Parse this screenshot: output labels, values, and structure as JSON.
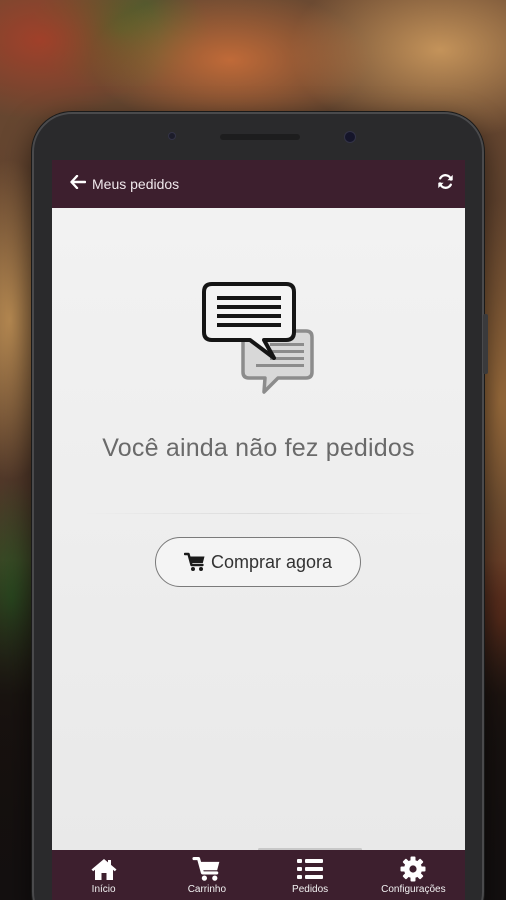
{
  "header": {
    "title": "Meus pedidos",
    "back_icon": "arrow-left-icon",
    "refresh_icon": "refresh-icon"
  },
  "empty_state": {
    "icon": "chat-bubbles-icon",
    "message": "Você ainda não fez pedidos",
    "button_icon": "shopping-cart-icon",
    "button_label": "Comprar agora"
  },
  "bottom_nav": {
    "items": [
      {
        "label": "Início",
        "icon": "home-icon"
      },
      {
        "label": "Carrinho",
        "icon": "cart-icon"
      },
      {
        "label": "Pedidos",
        "icon": "list-icon"
      },
      {
        "label": "Configurações",
        "icon": "gear-icon"
      }
    ]
  },
  "colors": {
    "bar": "#3d1f2e",
    "screen_bg": "#ececec",
    "text_muted": "#6a6a6a"
  }
}
